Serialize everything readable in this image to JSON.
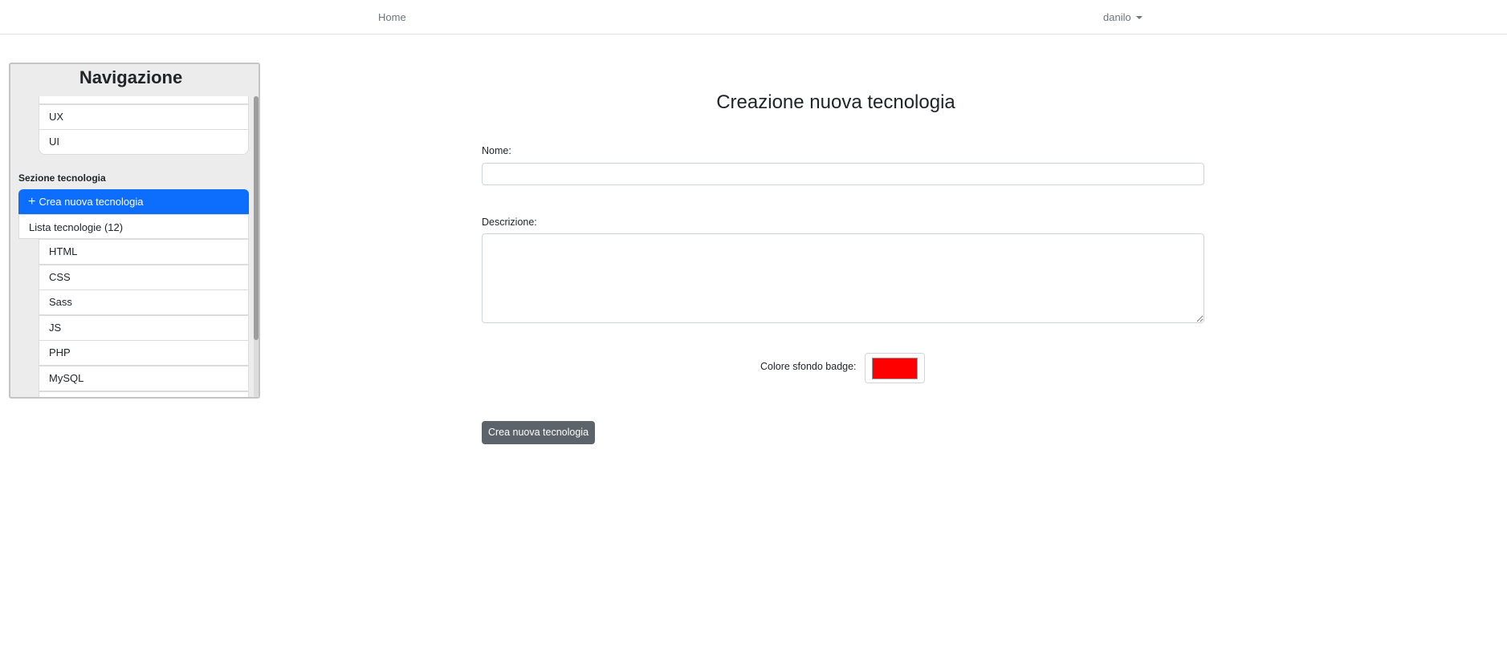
{
  "topbar": {
    "home_label": "Home",
    "user_label": "danilo"
  },
  "sidebar": {
    "title": "Navigazione",
    "upper_subitems": [
      "UX",
      "UI"
    ],
    "tech_section_label": "Sezione tecnologia",
    "create_label": "Crea nuova tecnologia",
    "list_label": "Lista tecnologie (12)",
    "tech_items": [
      "HTML",
      "CSS",
      "Sass",
      "JS",
      "PHP",
      "MySQL"
    ]
  },
  "form": {
    "title": "Creazione nuova tecnologia",
    "name_label": "Nome:",
    "name_value": "",
    "description_label": "Descrizione:",
    "description_value": "",
    "color_label": "Colore sfondo badge:",
    "color_value": "#ff0000",
    "submit_label": "Crea nuova tecnologia"
  },
  "colors": {
    "accent": "#0d6efd",
    "button": "#5c636a",
    "badge": "#ff0000"
  }
}
